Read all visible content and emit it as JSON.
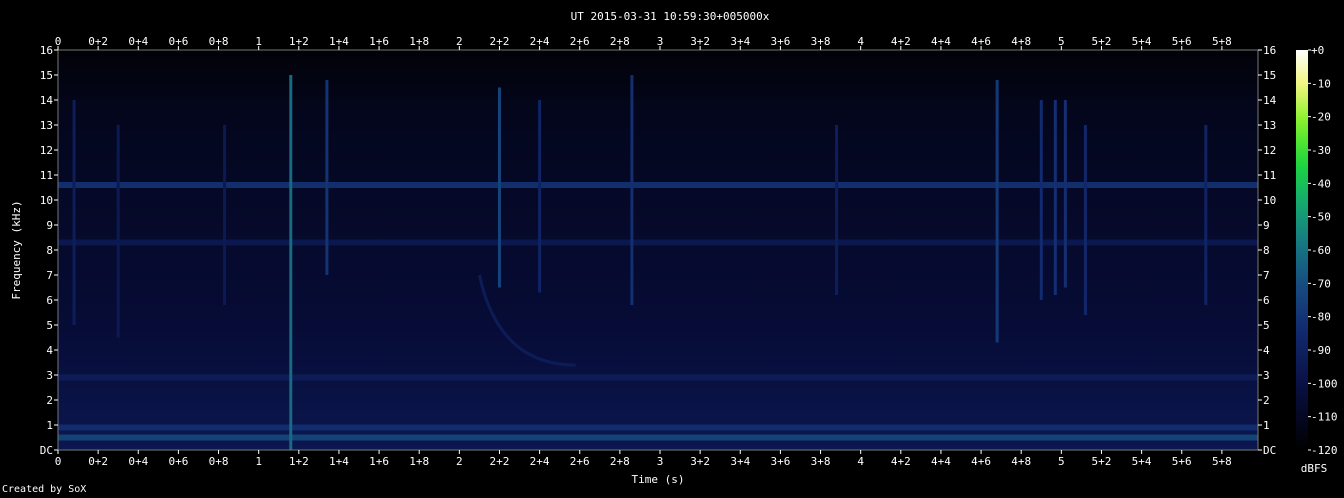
{
  "chart_data": {
    "type": "heatmap",
    "title": "UT 2015-03-31 10:59:30+005000x",
    "xlabel": "Time (s)",
    "ylabel": "Frequency (kHz)",
    "xlim": [
      0,
      5.98
    ],
    "ylim": [
      0,
      16
    ],
    "x_ticks": [
      "0",
      "0+2",
      "0+4",
      "0+6",
      "0+8",
      "1",
      "1+2",
      "1+4",
      "1+6",
      "1+8",
      "2",
      "2+2",
      "2+4",
      "2+6",
      "2+8",
      "3",
      "3+2",
      "3+4",
      "3+6",
      "3+8",
      "4",
      "4+2",
      "4+4",
      "4+6",
      "4+8",
      "5",
      "5+2",
      "5+4",
      "5+6",
      "5+8"
    ],
    "x_tick_values": [
      0,
      0.2,
      0.4,
      0.6,
      0.8,
      1,
      1.2,
      1.4,
      1.6,
      1.8,
      2,
      2.2,
      2.4,
      2.6,
      2.8,
      3,
      3.2,
      3.4,
      3.6,
      3.8,
      4,
      4.2,
      4.4,
      4.6,
      4.8,
      5,
      5.2,
      5.4,
      5.6,
      5.8
    ],
    "y_ticks": [
      "DC",
      "1",
      "2",
      "3",
      "4",
      "5",
      "6",
      "7",
      "8",
      "9",
      "10",
      "11",
      "12",
      "13",
      "14",
      "15",
      "16"
    ],
    "y_tick_values": [
      0,
      1,
      2,
      3,
      4,
      5,
      6,
      7,
      8,
      9,
      10,
      11,
      12,
      13,
      14,
      15,
      16
    ],
    "colorbar": {
      "label": "dBFS",
      "ticks": [
        "+0",
        "-10",
        "-20",
        "-30",
        "-40",
        "-50",
        "-60",
        "-70",
        "-80",
        "-90",
        "-100",
        "-110",
        "-120"
      ],
      "tick_values": [
        0,
        -10,
        -20,
        -30,
        -40,
        -50,
        -60,
        -70,
        -80,
        -90,
        -100,
        -110,
        -120
      ],
      "range": [
        -120,
        0
      ]
    },
    "horizontal_bands": [
      {
        "freq_khz": 0.5,
        "level_dbfs": -72
      },
      {
        "freq_khz": 0.9,
        "level_dbfs": -82
      },
      {
        "freq_khz": 2.9,
        "level_dbfs": -92
      },
      {
        "freq_khz": 8.3,
        "level_dbfs": -94
      },
      {
        "freq_khz": 10.6,
        "level_dbfs": -80
      }
    ],
    "vertical_events": [
      {
        "t": 0.08,
        "f_min": 5,
        "f_max": 14,
        "level_dbfs": -92
      },
      {
        "t": 0.3,
        "f_min": 4.5,
        "f_max": 13,
        "level_dbfs": -94
      },
      {
        "t": 0.83,
        "f_min": 5.8,
        "f_max": 13,
        "level_dbfs": -94
      },
      {
        "t": 1.16,
        "f_min": 0,
        "f_max": 15,
        "level_dbfs": -62
      },
      {
        "t": 1.34,
        "f_min": 7,
        "f_max": 14.8,
        "level_dbfs": -80
      },
      {
        "t": 2.2,
        "f_min": 6.5,
        "f_max": 14.5,
        "level_dbfs": -74
      },
      {
        "t": 2.4,
        "f_min": 6.3,
        "f_max": 14,
        "level_dbfs": -88
      },
      {
        "t": 2.86,
        "f_min": 5.8,
        "f_max": 15,
        "level_dbfs": -82
      },
      {
        "t": 3.88,
        "f_min": 6.2,
        "f_max": 13,
        "level_dbfs": -92
      },
      {
        "t": 4.68,
        "f_min": 4.3,
        "f_max": 14.8,
        "level_dbfs": -78
      },
      {
        "t": 4.9,
        "f_min": 6,
        "f_max": 14,
        "level_dbfs": -84
      },
      {
        "t": 4.97,
        "f_min": 6.2,
        "f_max": 14,
        "level_dbfs": -82
      },
      {
        "t": 5.02,
        "f_min": 6.5,
        "f_max": 14,
        "level_dbfs": -82
      },
      {
        "t": 5.12,
        "f_min": 5.4,
        "f_max": 13,
        "level_dbfs": -86
      },
      {
        "t": 5.72,
        "f_min": 5.8,
        "f_max": 13,
        "level_dbfs": -88
      }
    ],
    "sweeps": [
      {
        "t_start": 2.1,
        "f_start": 7.0,
        "t_end": 2.58,
        "f_end": 3.4,
        "level_dbfs": -92
      }
    ],
    "noise_floor_dbfs": -112
  },
  "footer": {
    "credit": "Created by SoX"
  }
}
